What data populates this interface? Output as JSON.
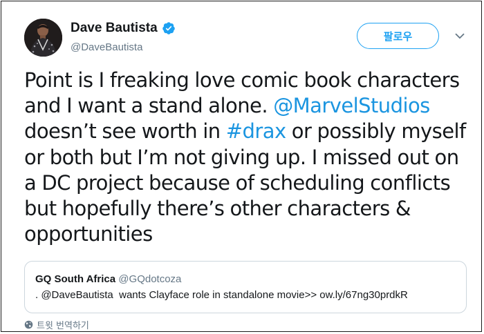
{
  "author": {
    "name": "Dave Bautista",
    "handle": "@DaveBautista",
    "verified": true
  },
  "follow_button": {
    "label": "팔로우"
  },
  "menu": {
    "icon": "chevron-down-icon"
  },
  "tweet": {
    "text_before": "Point is I freaking love comic book characters and I want a stand alone. ",
    "mention": "@MarvelStudios",
    "text_middle": " doesn’t see worth in ",
    "hashtag": "#drax",
    "text_after": " or possibly myself or both but I’m not giving up. I missed out on a DC project because of scheduling conflicts but hopefully there’s other characters & opportunities"
  },
  "quoted_tweet": {
    "name": "GQ South Africa",
    "handle": "@GQdotcoza",
    "text": ". @DaveBautista  wants Clayface role in standalone movie>> ow.ly/67ng30prdkR"
  },
  "translate": {
    "label": "트윗 번역하기",
    "icon": "globe-icon"
  },
  "colors": {
    "accent": "#1da1f2",
    "link": "#1b95e0",
    "text": "#14171a",
    "secondary": "#657786",
    "border": "#ccd6dd"
  }
}
